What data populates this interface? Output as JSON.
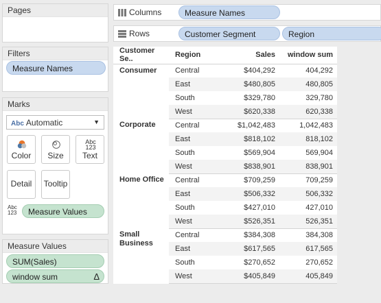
{
  "pages": {
    "title": "Pages"
  },
  "filters": {
    "title": "Filters",
    "pills": [
      "Measure Names"
    ]
  },
  "marks": {
    "title": "Marks",
    "type_select": {
      "value": "Automatic",
      "icon": "Abc"
    },
    "buttons": {
      "color": "Color",
      "size": "Size",
      "text": "Text",
      "text_icon": "Abc 123",
      "detail": "Detail",
      "tooltip": "Tooltip"
    },
    "measure_values_pill": "Measure Values",
    "measure_values_icon": "Abc 123"
  },
  "measure_values_card": {
    "title": "Measure Values",
    "pills": [
      "SUM(Sales)",
      "window sum"
    ],
    "delta": "Δ"
  },
  "columns": {
    "label": "Columns",
    "pills": [
      "Measure Names"
    ]
  },
  "rows": {
    "label": "Rows",
    "pills": [
      "Customer Segment",
      "Region"
    ]
  },
  "table": {
    "headers": {
      "segment": "Customer Se..",
      "region": "Region",
      "sales": "Sales",
      "window_sum": "window sum"
    },
    "groups": [
      {
        "segment": "Consumer",
        "rows": [
          {
            "region": "Central",
            "sales": "$404,292",
            "wsum": "404,292"
          },
          {
            "region": "East",
            "sales": "$480,805",
            "wsum": "480,805"
          },
          {
            "region": "South",
            "sales": "$329,780",
            "wsum": "329,780"
          },
          {
            "region": "West",
            "sales": "$620,338",
            "wsum": "620,338"
          }
        ]
      },
      {
        "segment": "Corporate",
        "rows": [
          {
            "region": "Central",
            "sales": "$1,042,483",
            "wsum": "1,042,483"
          },
          {
            "region": "East",
            "sales": "$818,102",
            "wsum": "818,102"
          },
          {
            "region": "South",
            "sales": "$569,904",
            "wsum": "569,904"
          },
          {
            "region": "West",
            "sales": "$838,901",
            "wsum": "838,901"
          }
        ]
      },
      {
        "segment": "Home Office",
        "rows": [
          {
            "region": "Central",
            "sales": "$709,259",
            "wsum": "709,259"
          },
          {
            "region": "East",
            "sales": "$506,332",
            "wsum": "506,332"
          },
          {
            "region": "South",
            "sales": "$427,010",
            "wsum": "427,010"
          },
          {
            "region": "West",
            "sales": "$526,351",
            "wsum": "526,351"
          }
        ]
      },
      {
        "segment": "Small Business",
        "rows": [
          {
            "region": "Central",
            "sales": "$384,308",
            "wsum": "384,308"
          },
          {
            "region": "East",
            "sales": "$617,565",
            "wsum": "617,565"
          },
          {
            "region": "South",
            "sales": "$270,652",
            "wsum": "270,652"
          },
          {
            "region": "West",
            "sales": "$405,849",
            "wsum": "405,849"
          }
        ]
      }
    ]
  }
}
